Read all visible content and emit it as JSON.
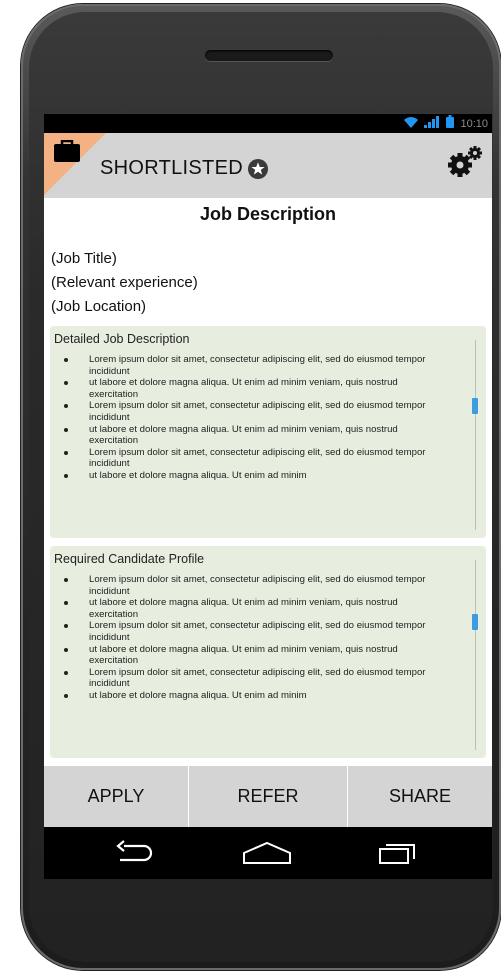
{
  "statusbar": {
    "time": "10:10",
    "wifi_icon": "wifi-icon",
    "signal_icon": "signal-icon",
    "battery_icon": "battery-icon"
  },
  "appbar": {
    "title": "SHORTLISTED",
    "briefcase_icon": "briefcase-icon",
    "star_icon": "star-icon",
    "settings_icon": "gears-icon"
  },
  "content": {
    "heading": "Job Description",
    "job_title": "(Job Title)",
    "experience": "(Relevant experience)",
    "location": "(Job Location)"
  },
  "panels": [
    {
      "title": "Detailed Job Description",
      "items": [
        "Lorem ipsum dolor sit amet, consectetur adipiscing elit, sed do eiusmod tempor incididunt",
        "ut labore et dolore magna aliqua. Ut enim ad minim veniam, quis nostrud exercitation",
        "Lorem ipsum dolor sit amet, consectetur adipiscing elit, sed do eiusmod tempor incididunt",
        "ut labore et dolore magna aliqua. Ut enim ad minim veniam, quis nostrud exercitation",
        "Lorem ipsum dolor sit amet, consectetur adipiscing elit, sed do eiusmod tempor incididunt",
        "ut labore et dolore magna aliqua. Ut enim ad minim"
      ]
    },
    {
      "title": "Required Candidate Profile",
      "items": [
        "Lorem ipsum dolor sit amet, consectetur adipiscing elit, sed do eiusmod tempor incididunt",
        "ut labore et dolore magna aliqua. Ut enim ad minim veniam, quis nostrud exercitation",
        "Lorem ipsum dolor sit amet, consectetur adipiscing elit, sed do eiusmod tempor incididunt",
        "ut labore et dolore magna aliqua. Ut enim ad minim veniam, quis nostrud exercitation",
        "Lorem ipsum dolor sit amet, consectetur adipiscing elit, sed do eiusmod tempor incididunt",
        "ut labore et dolore magna aliqua. Ut enim ad minim"
      ]
    }
  ],
  "actions": {
    "apply": "APPLY",
    "refer": "REFER",
    "share": "SHARE"
  },
  "navbar": {
    "back_icon": "back-icon",
    "home_icon": "home-icon",
    "recents_icon": "recent-apps-icon"
  },
  "colors": {
    "appbar_bg": "#d4d4d4",
    "accent_corner": "#f4b183",
    "panel_bg": "#e7eedf",
    "scroll_thumb": "#3d9be0",
    "status_accent": "#2196f3"
  }
}
